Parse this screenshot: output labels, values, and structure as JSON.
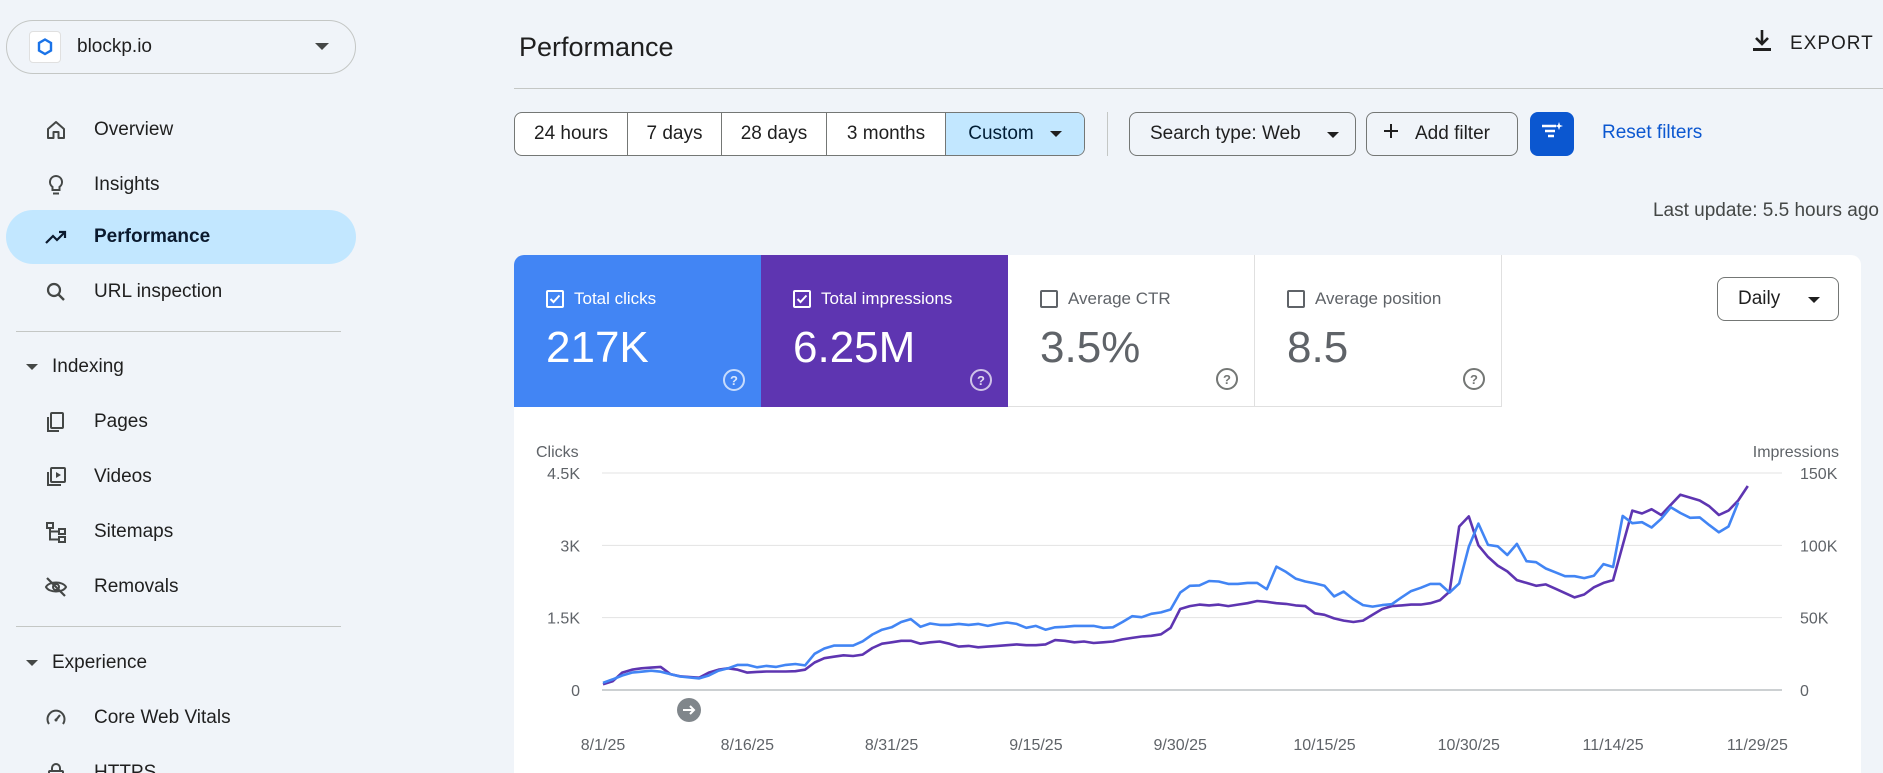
{
  "property": {
    "name": "blockp.io"
  },
  "nav": {
    "overview": "Overview",
    "insights": "Insights",
    "performance": "Performance",
    "url_inspection": "URL inspection",
    "indexing": "Indexing",
    "pages": "Pages",
    "videos": "Videos",
    "sitemaps": "Sitemaps",
    "removals": "Removals",
    "experience": "Experience",
    "core_web_vitals": "Core Web Vitals",
    "https": "HTTPS"
  },
  "header": {
    "title": "Performance",
    "export_label": "EXPORT"
  },
  "date_range": {
    "options": [
      "24 hours",
      "7 days",
      "28 days",
      "3 months"
    ],
    "custom_label": "Custom"
  },
  "filters": {
    "search_type": "Search type: Web",
    "add_filter": "Add filter",
    "reset": "Reset filters"
  },
  "last_update": "Last update: 5.5 hours ago",
  "metrics": {
    "clicks": {
      "label": "Total clicks",
      "value": "217K"
    },
    "impressions": {
      "label": "Total impressions",
      "value": "6.25M"
    },
    "ctr": {
      "label": "Average CTR",
      "value": "3.5%"
    },
    "position": {
      "label": "Average position",
      "value": "8.5"
    }
  },
  "granularity": "Daily",
  "colors": {
    "clicks": "#4285f4",
    "impressions": "#5e35b1",
    "accent": "#0b57d0",
    "active_nav": "#c2e7ff"
  },
  "chart_data": {
    "type": "line",
    "ylabel_left": "Clicks",
    "ylabel_right": "Impressions",
    "yticks_left": [
      "0",
      "1.5K",
      "3K",
      "4.5K"
    ],
    "yticks_right": [
      "0",
      "50K",
      "100K",
      "150K"
    ],
    "ylim_left": [
      0,
      4500
    ],
    "ylim_right": [
      0,
      150000
    ],
    "xticks": [
      "8/1/25",
      "8/16/25",
      "8/31/25",
      "9/15/25",
      "9/30/25",
      "10/15/25",
      "10/30/25",
      "11/14/25",
      "11/29/25"
    ],
    "x_start": "8/1/25",
    "grid": true,
    "series": [
      {
        "name": "Clicks",
        "axis": "left",
        "values": [
          150,
          220,
          300,
          360,
          380,
          400,
          380,
          330,
          280,
          260,
          240,
          300,
          400,
          450,
          520,
          520,
          470,
          500,
          480,
          520,
          540,
          510,
          750,
          860,
          920,
          920,
          920,
          1010,
          1150,
          1250,
          1300,
          1410,
          1470,
          1310,
          1380,
          1350,
          1350,
          1370,
          1350,
          1370,
          1330,
          1370,
          1400,
          1370,
          1290,
          1330,
          1250,
          1300,
          1310,
          1330,
          1330,
          1330,
          1290,
          1300,
          1410,
          1530,
          1510,
          1580,
          1610,
          1670,
          2020,
          2160,
          2170,
          2260,
          2250,
          2200,
          2200,
          2220,
          2220,
          2090,
          2560,
          2450,
          2310,
          2250,
          2210,
          2160,
          1940,
          2040,
          1880,
          1760,
          1730,
          1760,
          1780,
          1920,
          2050,
          2120,
          2200,
          2200,
          2020,
          2210,
          2970,
          3450,
          3010,
          2980,
          2800,
          3030,
          2670,
          2650,
          2520,
          2440,
          2360,
          2360,
          2320,
          2370,
          2610,
          2550,
          3610,
          3460,
          3480,
          3370,
          3550,
          3790,
          3670,
          3570,
          3580,
          3420,
          3270,
          3390,
          3890
        ]
      },
      {
        "name": "Impressions",
        "axis": "right",
        "values": [
          4000,
          6000,
          12000,
          14000,
          15000,
          15500,
          16000,
          11000,
          9500,
          9000,
          8500,
          12000,
          14000,
          15000,
          14000,
          12000,
          12500,
          12800,
          12800,
          12800,
          13000,
          14000,
          19000,
          22000,
          23000,
          24000,
          23500,
          24500,
          29000,
          32000,
          33000,
          34000,
          34000,
          32000,
          33000,
          33500,
          32000,
          30000,
          30500,
          29500,
          30000,
          30500,
          31000,
          31500,
          31000,
          31000,
          31500,
          34500,
          34000,
          33000,
          33500,
          32500,
          33000,
          33500,
          35000,
          36000,
          37000,
          37500,
          38500,
          43000,
          56000,
          58000,
          59000,
          58500,
          59000,
          58000,
          59000,
          60000,
          61500,
          61000,
          60000,
          59500,
          58500,
          58000,
          53000,
          52000,
          49500,
          48000,
          47000,
          48000,
          52000,
          56000,
          58000,
          58500,
          59000,
          59000,
          60000,
          62000,
          68000,
          113000,
          120000,
          100000,
          92000,
          86000,
          82000,
          76000,
          74000,
          72000,
          73000,
          70000,
          67000,
          64000,
          66000,
          71000,
          74000,
          76000,
          100000,
          124000,
          122000,
          125000,
          121000,
          128000,
          135000,
          133000,
          131000,
          127000,
          121000,
          124000,
          131000,
          141000
        ]
      }
    ]
  }
}
